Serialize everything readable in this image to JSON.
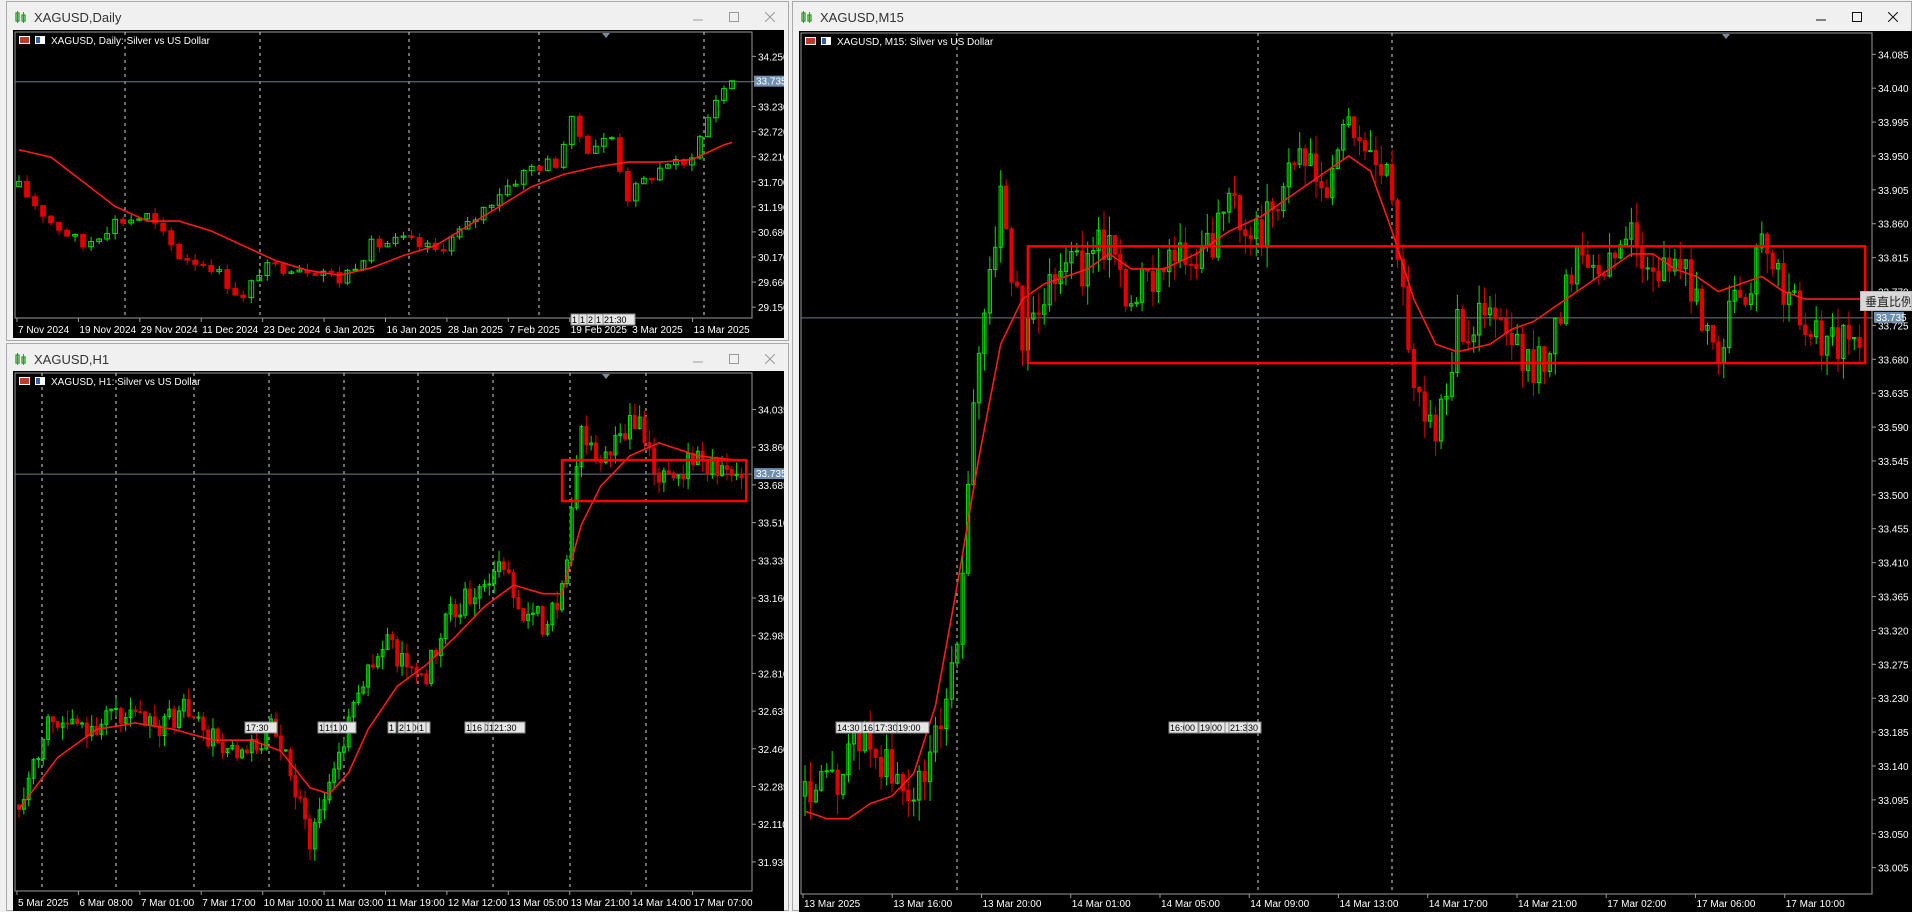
{
  "colors": {
    "bull": "#00e000",
    "bear": "#e00000",
    "ma": "#ff1a1a",
    "box": "#ff0000",
    "grid": "#d9d9d9",
    "bid_line": "#6f7c88",
    "price_tag": "#6f8fb0"
  },
  "windows": [
    {
      "id": "daily",
      "title": "XAGUSD,Daily",
      "header": "XAGUSD, Daily:  Silver vs US Dollar",
      "active": false,
      "current_price": "33.735",
      "chart_data": {
        "type": "candlestick",
        "title": "XAGUSD, Daily:  Silver vs US Dollar",
        "ylim": [
          28.93,
          34.42
        ],
        "y_ticks": [
          "34.250",
          "33.740",
          "33.230",
          "32.720",
          "32.210",
          "31.700",
          "31.190",
          "30.680",
          "30.170",
          "29.660",
          "29.150"
        ],
        "y_tick_values": [
          34.25,
          33.74,
          33.23,
          32.72,
          32.21,
          31.7,
          31.19,
          30.68,
          30.17,
          29.66,
          29.15
        ],
        "x_labels": [
          "7 Nov 2024",
          "19 Nov 2024",
          "29 Nov 2024",
          "11 Dec 2024",
          "23 Dec 2024",
          "6 Jan 2025",
          "16 Jan 2025",
          "28 Jan 2025",
          "7 Feb 2025",
          "19 Feb 2025",
          "3 Mar 2025",
          "13 Mar 2025"
        ],
        "bars": 90,
        "close_path": [
          [
            0,
            31.6
          ],
          [
            4,
            30.9
          ],
          [
            8,
            30.4
          ],
          [
            12,
            30.9
          ],
          [
            16,
            31.0
          ],
          [
            20,
            30.2
          ],
          [
            24,
            30.0
          ],
          [
            28,
            29.3
          ],
          [
            30,
            29.9
          ],
          [
            34,
            30.0
          ],
          [
            38,
            29.9
          ],
          [
            40,
            29.7
          ],
          [
            44,
            30.4
          ],
          [
            48,
            30.5
          ],
          [
            52,
            30.3
          ],
          [
            56,
            30.8
          ],
          [
            60,
            31.5
          ],
          [
            64,
            32.0
          ],
          [
            67,
            32.1
          ],
          [
            69,
            32.9
          ],
          [
            71,
            32.4
          ],
          [
            74,
            32.6
          ],
          [
            76,
            31.4
          ],
          [
            78,
            31.7
          ],
          [
            81,
            32.1
          ],
          [
            83,
            32.0
          ],
          [
            85,
            32.6
          ],
          [
            87,
            33.4
          ],
          [
            89,
            33.8
          ]
        ],
        "ma": [
          [
            0,
            32.35
          ],
          [
            4,
            32.2
          ],
          [
            8,
            31.7
          ],
          [
            12,
            31.2
          ],
          [
            16,
            30.9
          ],
          [
            20,
            30.9
          ],
          [
            24,
            30.7
          ],
          [
            28,
            30.4
          ],
          [
            32,
            30.1
          ],
          [
            36,
            29.9
          ],
          [
            40,
            29.8
          ],
          [
            44,
            29.95
          ],
          [
            48,
            30.2
          ],
          [
            52,
            30.4
          ],
          [
            56,
            30.8
          ],
          [
            60,
            31.2
          ],
          [
            64,
            31.6
          ],
          [
            68,
            31.85
          ],
          [
            72,
            32.0
          ],
          [
            76,
            32.1
          ],
          [
            80,
            32.1
          ],
          [
            84,
            32.15
          ],
          [
            88,
            32.45
          ],
          [
            89,
            32.5
          ]
        ],
        "markers": [
          "1",
          "1",
          "2",
          "1",
          "21:30"
        ]
      }
    },
    {
      "id": "h1",
      "title": "XAGUSD,H1",
      "header": "XAGUSD, H1:  Silver vs US Dollar",
      "active": false,
      "current_price": "33.735",
      "chart_data": {
        "type": "candlestick",
        "title": "XAGUSD, H1:  Silver vs US Dollar",
        "ylim": [
          31.8,
          34.13
        ],
        "y_ticks": [
          "34.035",
          "33.860",
          "33.685",
          "33.510",
          "33.335",
          "33.160",
          "32.985",
          "32.810",
          "32.635",
          "32.460",
          "32.285",
          "32.110",
          "31.935"
        ],
        "y_tick_values": [
          34.035,
          33.86,
          33.685,
          33.51,
          33.335,
          33.16,
          32.985,
          32.81,
          32.635,
          32.46,
          32.285,
          32.11,
          31.935
        ],
        "x_labels": [
          "5 Mar 2025",
          "6 Mar 08:00",
          "7 Mar 01:00",
          "7 Mar 17:00",
          "10 Mar 10:00",
          "11 Mar 03:00",
          "11 Mar 19:00",
          "12 Mar 12:00",
          "13 Mar 05:00",
          "13 Mar 21:00",
          "14 Mar 14:00",
          "17 Mar 07:00"
        ],
        "bars": 150,
        "close_path": [
          [
            0,
            32.2
          ],
          [
            6,
            32.6
          ],
          [
            12,
            32.55
          ],
          [
            18,
            32.6
          ],
          [
            22,
            32.62
          ],
          [
            28,
            32.55
          ],
          [
            34,
            32.65
          ],
          [
            40,
            32.5
          ],
          [
            46,
            32.4
          ],
          [
            52,
            32.55
          ],
          [
            56,
            32.35
          ],
          [
            60,
            32.05
          ],
          [
            64,
            32.3
          ],
          [
            70,
            32.75
          ],
          [
            76,
            32.95
          ],
          [
            80,
            32.85
          ],
          [
            84,
            32.8
          ],
          [
            88,
            33.05
          ],
          [
            92,
            33.15
          ],
          [
            96,
            33.25
          ],
          [
            100,
            33.3
          ],
          [
            104,
            33.1
          ],
          [
            108,
            33.05
          ],
          [
            112,
            33.2
          ],
          [
            116,
            33.9
          ],
          [
            120,
            33.8
          ],
          [
            124,
            33.9
          ],
          [
            128,
            34.0
          ],
          [
            132,
            33.7
          ],
          [
            136,
            33.75
          ],
          [
            140,
            33.82
          ],
          [
            144,
            33.76
          ],
          [
            148,
            33.72
          ]
        ],
        "ma": [
          [
            0,
            32.18
          ],
          [
            8,
            32.42
          ],
          [
            16,
            32.55
          ],
          [
            24,
            32.58
          ],
          [
            32,
            32.55
          ],
          [
            40,
            32.5
          ],
          [
            48,
            32.5
          ],
          [
            54,
            32.45
          ],
          [
            60,
            32.28
          ],
          [
            64,
            32.25
          ],
          [
            68,
            32.35
          ],
          [
            72,
            32.55
          ],
          [
            78,
            32.75
          ],
          [
            84,
            32.85
          ],
          [
            90,
            32.98
          ],
          [
            96,
            33.12
          ],
          [
            102,
            33.22
          ],
          [
            108,
            33.18
          ],
          [
            112,
            33.18
          ],
          [
            116,
            33.5
          ],
          [
            120,
            33.68
          ],
          [
            126,
            33.82
          ],
          [
            132,
            33.88
          ],
          [
            140,
            33.82
          ],
          [
            148,
            33.8
          ]
        ],
        "box": {
          "x0": 112,
          "x1": 150,
          "y_top": 33.8,
          "y_bottom": 33.61
        },
        "markers": [
          "17:30",
          "1",
          "19:00",
          "1",
          "1",
          "20:00",
          "1",
          "1",
          "19:00",
          "16",
          "1",
          "21:30"
        ]
      }
    },
    {
      "id": "m15",
      "title": "XAGUSD,M15",
      "header": "XAGUSD, M15:  Silver vs US Dollar",
      "active": true,
      "current_price": "33.735",
      "side_label": "垂直比例",
      "chart_data": {
        "type": "candlestick",
        "title": "XAGUSD, M15:  Silver vs US Dollar",
        "ylim": [
          32.97,
          34.1
        ],
        "y_ticks": [
          "34.085",
          "34.040",
          "33.995",
          "33.950",
          "33.905",
          "33.860",
          "33.815",
          "33.770",
          "33.725",
          "33.680",
          "33.635",
          "33.590",
          "33.545",
          "33.500",
          "33.455",
          "33.410",
          "33.365",
          "33.320",
          "33.275",
          "33.230",
          "33.185",
          "33.140",
          "33.095",
          "33.050",
          "33.005"
        ],
        "y_tick_values": [
          34.085,
          34.04,
          33.995,
          33.95,
          33.905,
          33.86,
          33.815,
          33.77,
          33.725,
          33.68,
          33.635,
          33.59,
          33.545,
          33.5,
          33.455,
          33.41,
          33.365,
          33.32,
          33.275,
          33.23,
          33.185,
          33.14,
          33.095,
          33.05,
          33.005
        ],
        "x_labels": [
          "13 Mar 2025",
          "13 Mar 16:00",
          "13 Mar 20:00",
          "14 Mar 01:00",
          "14 Mar 05:00",
          "14 Mar 09:00",
          "14 Mar 13:00",
          "14 Mar 17:00",
          "14 Mar 21:00",
          "17 Mar 02:00",
          "17 Mar 06:00",
          "17 Mar 10:00"
        ],
        "bars": 195,
        "close_path": [
          [
            0,
            33.1
          ],
          [
            6,
            33.12
          ],
          [
            10,
            33.18
          ],
          [
            14,
            33.15
          ],
          [
            18,
            33.1
          ],
          [
            22,
            33.12
          ],
          [
            28,
            33.3
          ],
          [
            32,
            33.7
          ],
          [
            36,
            33.9
          ],
          [
            40,
            33.7
          ],
          [
            44,
            33.78
          ],
          [
            48,
            33.82
          ],
          [
            52,
            33.8
          ],
          [
            56,
            33.85
          ],
          [
            60,
            33.75
          ],
          [
            66,
            33.82
          ],
          [
            72,
            33.8
          ],
          [
            78,
            33.88
          ],
          [
            84,
            33.85
          ],
          [
            90,
            33.95
          ],
          [
            96,
            33.9
          ],
          [
            100,
            34.0
          ],
          [
            104,
            33.95
          ],
          [
            108,
            33.9
          ],
          [
            112,
            33.65
          ],
          [
            116,
            33.58
          ],
          [
            120,
            33.72
          ],
          [
            126,
            33.74
          ],
          [
            130,
            33.7
          ],
          [
            134,
            33.66
          ],
          [
            138,
            33.72
          ],
          [
            142,
            33.83
          ],
          [
            148,
            33.8
          ],
          [
            152,
            33.86
          ],
          [
            156,
            33.78
          ],
          [
            160,
            33.82
          ],
          [
            164,
            33.75
          ],
          [
            168,
            33.7
          ],
          [
            172,
            33.76
          ],
          [
            176,
            33.82
          ],
          [
            180,
            33.78
          ],
          [
            184,
            33.72
          ],
          [
            188,
            33.7
          ]
        ],
        "ma": [
          [
            0,
            33.08
          ],
          [
            4,
            33.07
          ],
          [
            8,
            33.07
          ],
          [
            12,
            33.09
          ],
          [
            16,
            33.1
          ],
          [
            20,
            33.13
          ],
          [
            24,
            33.22
          ],
          [
            28,
            33.38
          ],
          [
            32,
            33.55
          ],
          [
            36,
            33.7
          ],
          [
            40,
            33.76
          ],
          [
            44,
            33.78
          ],
          [
            48,
            33.79
          ],
          [
            52,
            33.8
          ],
          [
            56,
            33.82
          ],
          [
            60,
            33.8
          ],
          [
            66,
            33.8
          ],
          [
            72,
            33.82
          ],
          [
            78,
            33.85
          ],
          [
            84,
            33.87
          ],
          [
            90,
            33.9
          ],
          [
            96,
            33.93
          ],
          [
            100,
            33.95
          ],
          [
            104,
            33.93
          ],
          [
            108,
            33.85
          ],
          [
            112,
            33.76
          ],
          [
            116,
            33.7
          ],
          [
            120,
            33.69
          ],
          [
            126,
            33.7
          ],
          [
            130,
            33.72
          ],
          [
            134,
            33.73
          ],
          [
            138,
            33.75
          ],
          [
            142,
            33.77
          ],
          [
            148,
            33.8
          ],
          [
            152,
            33.82
          ],
          [
            156,
            33.82
          ],
          [
            160,
            33.8
          ],
          [
            164,
            33.79
          ],
          [
            168,
            33.77
          ],
          [
            172,
            33.78
          ],
          [
            176,
            33.79
          ],
          [
            180,
            33.77
          ],
          [
            184,
            33.76
          ],
          [
            188,
            33.76
          ]
        ],
        "box": {
          "x0": 41,
          "x1": 195,
          "y_top": 33.83,
          "y_bottom": 33.675
        },
        "markers": [
          "14:30",
          "16:",
          "17:30",
          "19:00",
          "16:00",
          "00",
          "19:00",
          "00",
          "21:30",
          "30"
        ]
      }
    }
  ]
}
